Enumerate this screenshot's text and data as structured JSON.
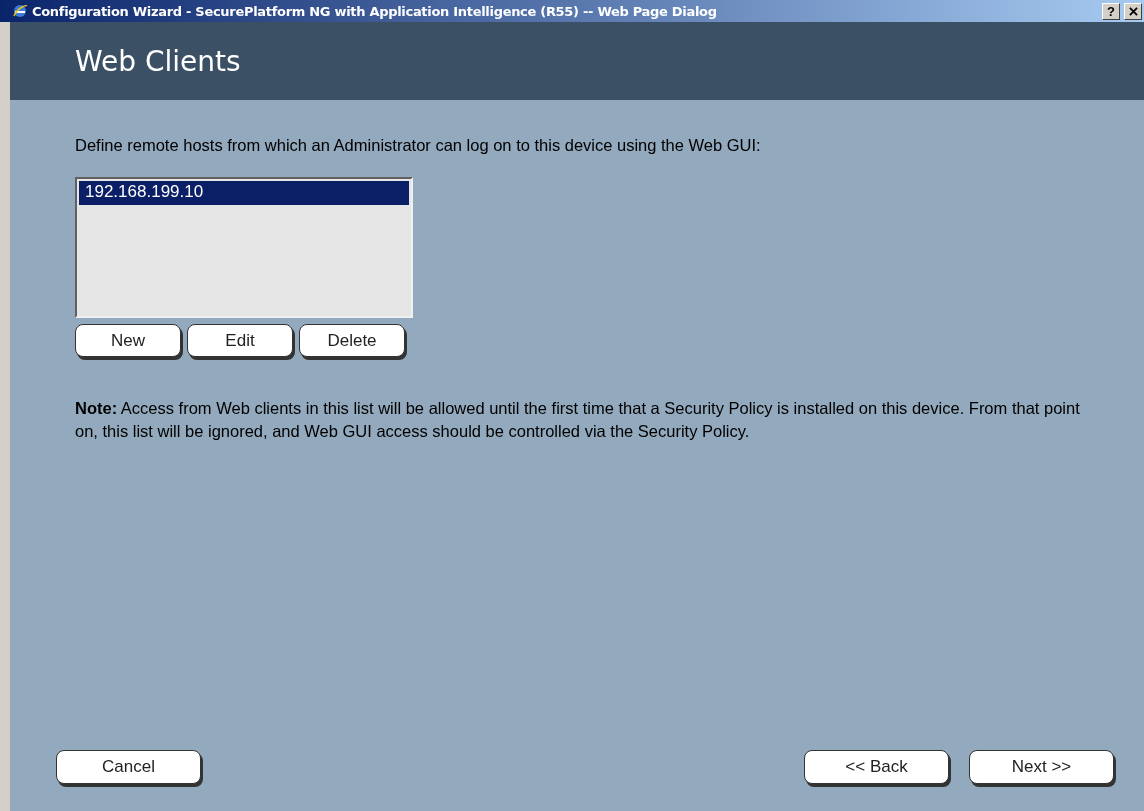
{
  "window": {
    "title": "Configuration Wizard - SecurePlatform NG with Application Intelligence (R55) -- Web Page Dialog",
    "help": "?"
  },
  "header": {
    "title": "Web Clients"
  },
  "intro": "Define remote hosts from which an Administrator can log on to this device using the Web GUI:",
  "hosts": [
    {
      "label": "192.168.199.10",
      "selected": true
    }
  ],
  "list_buttons": [
    "New",
    "Edit",
    "Delete"
  ],
  "note": "**Note:** Access from Web clients in this list will be allowed until the first time that a Security Policy is installed on this device. From that point on, this list will be ignored, and Web GUI access should be controlled via the Security Policy.",
  "footer": {
    "left": [
      "Cancel"
    ],
    "right": [
      "<< Back",
      "Next >>"
    ]
  }
}
